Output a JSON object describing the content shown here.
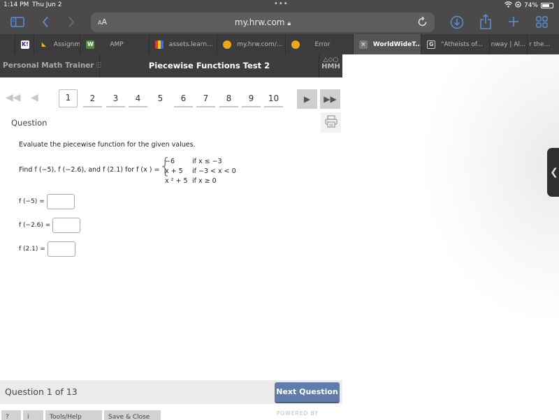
{
  "status_bar": {
    "time": "1:14 PM",
    "date": "Thu Jun 2",
    "battery_percent": "74%",
    "battery_level": 0.74
  },
  "browser": {
    "text_size_label": "AA",
    "url": "my.hrw.com",
    "secure": true,
    "icons": [
      "sidebar-icon",
      "back-icon",
      "forward-icon",
      "reload-icon",
      "download-icon",
      "share-icon",
      "new-tab-icon",
      "tab-overview-icon"
    ]
  },
  "tabs": [
    {
      "label": "",
      "favicon": "K!",
      "favicon_color": "#46178f"
    },
    {
      "label": "Assignme",
      "favicon": "",
      "favicon_color": "#f0b42a"
    },
    {
      "label": "AMP",
      "favicon": "W",
      "favicon_color": "#4f8f3b"
    },
    {
      "label": "assets.learn...",
      "favicon": "",
      "favicon_color": "#e5352f"
    },
    {
      "label": "my.hrw.com/...",
      "favicon": "",
      "favicon_color": "#f0a818"
    },
    {
      "label": "Error",
      "favicon": "",
      "favicon_color": "#f0a818"
    },
    {
      "label": "WorldWideT...",
      "favicon": "×",
      "favicon_color": "#888888",
      "active": true
    },
    {
      "label": "\"Atheists of...",
      "favicon": "G",
      "favicon_color": "#3c3c3c"
    },
    {
      "label": "nway | Al...",
      "favicon": ""
    },
    {
      "label": "r the...",
      "favicon": ""
    }
  ],
  "app": {
    "brand": "Personal Math Trainer",
    "title": "Piecewise Functions Test 2",
    "logo": "HMH",
    "logo_shapes": "△◇○"
  },
  "pager": {
    "pages": [
      "1",
      "2",
      "3",
      "4",
      "5",
      "6",
      "7",
      "8",
      "9",
      "10"
    ],
    "current": "1"
  },
  "question": {
    "heading": "Question",
    "prompt": "Evaluate the piecewise function for the given values.",
    "find_text": "Find f (−5), f (−2.6), and f (2.1) for f (x ) =",
    "pieces": [
      {
        "expr": "−6",
        "cond": "if  x  ≤ −3"
      },
      {
        "expr": "x  + 5",
        "cond": "if  −3 < x  < 0"
      },
      {
        "expr": "x ² + 5",
        "cond": "if  x  ≥ 0"
      }
    ],
    "answers": [
      {
        "label": "f (−5) =",
        "value": ""
      },
      {
        "label": "f (−2.6) =",
        "value": ""
      },
      {
        "label": "f (2.1) =",
        "value": ""
      }
    ]
  },
  "footer": {
    "question_count": "Question 1 of 13",
    "next_label": "Next Question",
    "bottom_buttons": [
      "?",
      "i",
      "Tools/Help",
      "Save & Close"
    ],
    "powered_by": "POWERED BY"
  }
}
